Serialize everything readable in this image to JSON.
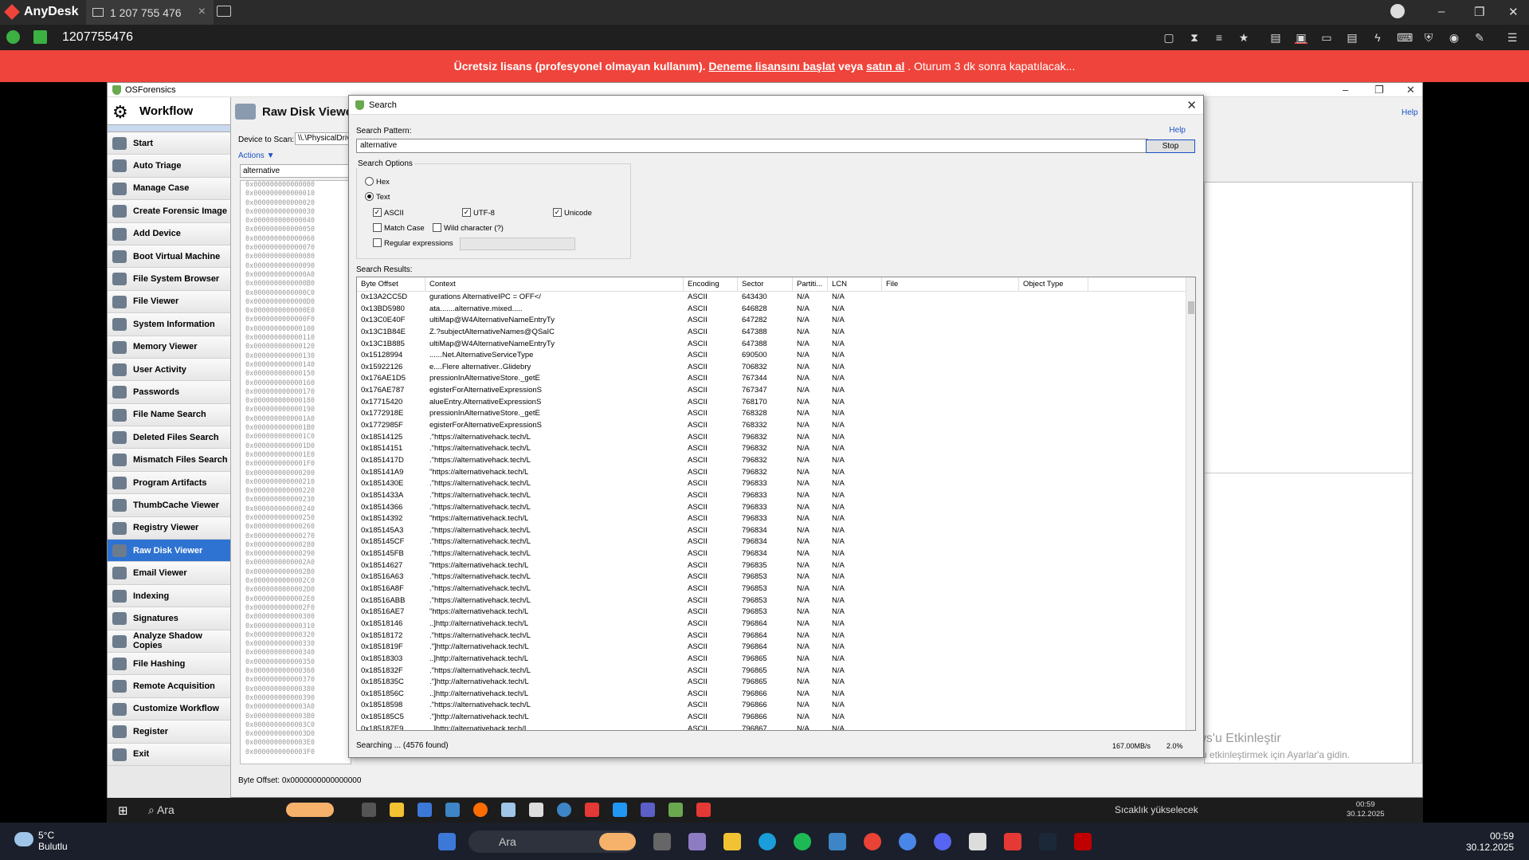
{
  "anydesk": {
    "app": "AnyDesk",
    "tab": "1 207 755 476",
    "address": "1207755476"
  },
  "banner": {
    "text1": "Ücretsiz lisans (profesyonel olmayan kullanım).",
    "link1": "Deneme lisansını başlat",
    "mid": "veya",
    "link2": "satın al",
    "text2": ". Oturum 3 dk sonra kapatılacak..."
  },
  "osf": {
    "title": "OSForensics",
    "help": "Help"
  },
  "workflow": {
    "title": "Workflow",
    "items": [
      "Start",
      "Auto Triage",
      "Manage Case",
      "Create Forensic Image",
      "Add Device",
      "Boot Virtual Machine",
      "File System Browser",
      "File Viewer",
      "System Information",
      "Memory Viewer",
      "User Activity",
      "Passwords",
      "File Name Search",
      "Deleted Files Search",
      "Mismatch Files Search",
      "Program Artifacts",
      "ThumbCache Viewer",
      "Registry Viewer",
      "Raw Disk Viewer",
      "Email Viewer",
      "Indexing",
      "Signatures",
      "Analyze Shadow Copies",
      "File Hashing",
      "Remote Acquisition",
      "Customize Workflow",
      "Register",
      "Exit"
    ],
    "active": "Raw Disk Viewer"
  },
  "rdv": {
    "title": "Raw Disk Viewer",
    "device_label": "Device to Scan:",
    "device_value": "\\\\.\\PhysicalDriv",
    "actions": "Actions ▼",
    "search_value": "alternative",
    "offset_label": "Byte Offset: 0x0000000000000000"
  },
  "hex": [
    "0x000000000000000",
    "0x000000000000010",
    "0x000000000000020",
    "0x000000000000030",
    "0x000000000000040",
    "0x000000000000050",
    "0x000000000000060",
    "0x000000000000070",
    "0x000000000000080",
    "0x000000000000090",
    "0x0000000000000A0",
    "0x0000000000000B0",
    "0x0000000000000C0",
    "0x0000000000000D0",
    "0x0000000000000E0",
    "0x0000000000000F0",
    "0x000000000000100",
    "0x000000000000110",
    "0x000000000000120",
    "0x000000000000130",
    "0x000000000000140",
    "0x000000000000150",
    "0x000000000000160",
    "0x000000000000170",
    "0x000000000000180",
    "0x000000000000190",
    "0x0000000000001A0",
    "0x0000000000001B0",
    "0x0000000000001C0",
    "0x0000000000001D0",
    "0x0000000000001E0",
    "0x0000000000001F0",
    "0x000000000000200",
    "0x000000000000210",
    "0x000000000000220",
    "0x000000000000230",
    "0x000000000000240",
    "0x000000000000250",
    "0x000000000000260",
    "0x000000000000270",
    "0x000000000000280",
    "0x000000000000290",
    "0x0000000000002A0",
    "0x0000000000002B0",
    "0x0000000000002C0",
    "0x0000000000002D0",
    "0x0000000000002E0",
    "0x0000000000002F0",
    "0x000000000000300",
    "0x000000000000310",
    "0x000000000000320",
    "0x000000000000330",
    "0x000000000000340",
    "0x000000000000350",
    "0x000000000000360",
    "0x000000000000370",
    "0x000000000000380",
    "0x000000000000390",
    "0x0000000000003A0",
    "0x0000000000003B0",
    "0x0000000000003C0",
    "0x0000000000003D0",
    "0x0000000000003E0",
    "0x0000000000003F0"
  ],
  "watermark": {
    "line1": "Windows'u Etkinleştir",
    "line2": "Windows'u etkinleştirmek için Ayarlar'a gidin."
  },
  "dialog": {
    "title": "Search",
    "pattern_label": "Search Pattern:",
    "help": "Help",
    "pattern": "alternative",
    "stop": "Stop",
    "options_label": "Search Options",
    "hex": "Hex",
    "text": "Text",
    "ascii": "ASCII",
    "utf8": "UTF-8",
    "unicode": "Unicode",
    "match_case": "Match Case",
    "wild": "Wild character (?)",
    "regex": "Regular expressions",
    "results_label": "Search Results:",
    "status": "Searching ... (4576 found)",
    "speed": "167.00MB/s",
    "pct": "2.0%"
  },
  "columns": [
    "Byte Offset",
    "Context",
    "Encoding",
    "Sector",
    "Partiti...",
    "LCN",
    "File",
    "Object Type"
  ],
  "rows": [
    [
      "0x13A2CC5D",
      "gurations AlternativeIPC = OFF</",
      "ASCII",
      "643430",
      "N/A",
      "N/A"
    ],
    [
      "0x13BD5980",
      "ata.......alternative.mixed.....",
      "ASCII",
      "646828",
      "N/A",
      "N/A"
    ],
    [
      "0x13C0E40F",
      "ultiMap@W4AlternativeNameEntryTy",
      "ASCII",
      "647282",
      "N/A",
      "N/A"
    ],
    [
      "0x13C1B84E",
      "Z.?subjectAlternativeNames@QSaIC",
      "ASCII",
      "647388",
      "N/A",
      "N/A"
    ],
    [
      "0x13C1B885",
      "ultiMap@W4AlternativeNameEntryTy",
      "ASCII",
      "647388",
      "N/A",
      "N/A"
    ],
    [
      "0x15128994",
      "......Net.AlternativeServiceType",
      "ASCII",
      "690500",
      "N/A",
      "N/A"
    ],
    [
      "0x15922126",
      "e....Flere alternativer..Glidebry",
      "ASCII",
      "706832",
      "N/A",
      "N/A"
    ],
    [
      "0x176AE1D5",
      "pressionInAlternativeStore._getE",
      "ASCII",
      "767344",
      "N/A",
      "N/A"
    ],
    [
      "0x176AE787",
      "egisterForAlternativeExpressionS",
      "ASCII",
      "767347",
      "N/A",
      "N/A"
    ],
    [
      "0x17715420",
      "alueEntry.AlternativeExpressionS",
      "ASCII",
      "768170",
      "N/A",
      "N/A"
    ],
    [
      "0x1772918E",
      "pressionInAlternativeStore._getE",
      "ASCII",
      "768328",
      "N/A",
      "N/A"
    ],
    [
      "0x1772985F",
      "egisterForAlternativeExpressionS",
      "ASCII",
      "768332",
      "N/A",
      "N/A"
    ],
    [
      "0x18514125",
      ".\"https://alternativehack.tech/L",
      "ASCII",
      "796832",
      "N/A",
      "N/A"
    ],
    [
      "0x18514151",
      ".\"https://alternativehack.tech/L",
      "ASCII",
      "796832",
      "N/A",
      "N/A"
    ],
    [
      "0x1851417D",
      ".\"https://alternativehack.tech/L",
      "ASCII",
      "796832",
      "N/A",
      "N/A"
    ],
    [
      "0x185141A9",
      "\"https://alternativehack.tech/L",
      "ASCII",
      "796832",
      "N/A",
      "N/A"
    ],
    [
      "0x1851430E",
      ".\"https://alternativehack.tech/L",
      "ASCII",
      "796833",
      "N/A",
      "N/A"
    ],
    [
      "0x1851433A",
      ".\"https://alternativehack.tech/L",
      "ASCII",
      "796833",
      "N/A",
      "N/A"
    ],
    [
      "0x18514366",
      ".\"https://alternativehack.tech/L",
      "ASCII",
      "796833",
      "N/A",
      "N/A"
    ],
    [
      "0x18514392",
      "\"https://alternativehack.tech/L",
      "ASCII",
      "796833",
      "N/A",
      "N/A"
    ],
    [
      "0x185145A3",
      ".\"https://alternativehack.tech/L",
      "ASCII",
      "796834",
      "N/A",
      "N/A"
    ],
    [
      "0x185145CF",
      ".\"https://alternativehack.tech/L",
      "ASCII",
      "796834",
      "N/A",
      "N/A"
    ],
    [
      "0x185145FB",
      ".\"https://alternativehack.tech/L",
      "ASCII",
      "796834",
      "N/A",
      "N/A"
    ],
    [
      "0x18514627",
      "\"https://alternativehack.tech/L",
      "ASCII",
      "796835",
      "N/A",
      "N/A"
    ],
    [
      "0x18516A63",
      ".\"https://alternativehack.tech/L",
      "ASCII",
      "796853",
      "N/A",
      "N/A"
    ],
    [
      "0x18516A8F",
      ".\"https://alternativehack.tech/L",
      "ASCII",
      "796853",
      "N/A",
      "N/A"
    ],
    [
      "0x18516ABB",
      ".\"https://alternativehack.tech/L",
      "ASCII",
      "796853",
      "N/A",
      "N/A"
    ],
    [
      "0x18516AE7",
      "\"https://alternativehack.tech/L",
      "ASCII",
      "796853",
      "N/A",
      "N/A"
    ],
    [
      "0x18518146",
      "..]http://alternativehack.tech/L",
      "ASCII",
      "796864",
      "N/A",
      "N/A"
    ],
    [
      "0x18518172",
      ".\"https://alternativehack.tech/L",
      "ASCII",
      "796864",
      "N/A",
      "N/A"
    ],
    [
      "0x1851819F",
      ".\"]http://alternativehack.tech/L",
      "ASCII",
      "796864",
      "N/A",
      "N/A"
    ],
    [
      "0x18518303",
      "..]http://alternativehack.tech/L",
      "ASCII",
      "796865",
      "N/A",
      "N/A"
    ],
    [
      "0x1851832F",
      ".\"https://alternativehack.tech/L",
      "ASCII",
      "796865",
      "N/A",
      "N/A"
    ],
    [
      "0x1851835C",
      ".\"]http://alternativehack.tech/L",
      "ASCII",
      "796865",
      "N/A",
      "N/A"
    ],
    [
      "0x1851856C",
      "..]http://alternativehack.tech/L",
      "ASCII",
      "796866",
      "N/A",
      "N/A"
    ],
    [
      "0x18518598",
      ".\"https://alternativehack.tech/L",
      "ASCII",
      "796866",
      "N/A",
      "N/A"
    ],
    [
      "0x185185C5",
      ".\"]http://alternativehack.tech/L",
      "ASCII",
      "796866",
      "N/A",
      "N/A"
    ],
    [
      "0x185187E9",
      "..]http://alternativehack.tech/L",
      "ASCII",
      "796867",
      "N/A",
      "N/A"
    ]
  ],
  "taskbar_remote": {
    "search": "Ara",
    "weather": "Sıcaklık yükselecek",
    "time": "00:59",
    "date": "30.12.2025"
  },
  "taskbar_local": {
    "temp": "5°C",
    "cond": "Bulutlu",
    "search": "Ara",
    "time": "00:59",
    "date": "30.12.2025"
  }
}
